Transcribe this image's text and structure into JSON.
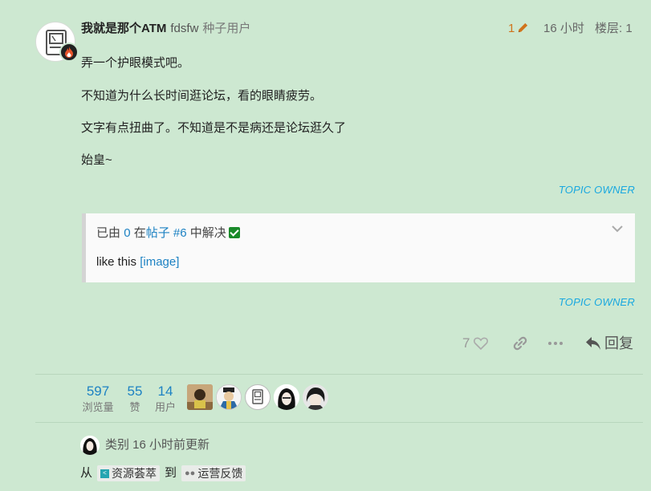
{
  "post": {
    "username": "我就是那个ATM",
    "second_name": "fdsfw",
    "user_title": "种子用户",
    "edit_count": "1",
    "time": "16 小时",
    "floor": "楼层: 1",
    "paragraphs": [
      "弄一个护眼模式吧。",
      "不知道为什么长时间逛论坛，看的眼睛疲劳。",
      "文字有点扭曲了。不知道是不是病还是论坛逛久了",
      "始皇~"
    ],
    "owner_tag": "TOPIC OWNER"
  },
  "solution": {
    "prefix": "已由",
    "solver": "0",
    "mid": "在",
    "post_link": "帖子 #6",
    "suffix": "中解决",
    "quote_text": "like this",
    "image_link": "[image]"
  },
  "actions": {
    "like_count": "7",
    "reply_label": "回复"
  },
  "stats": [
    {
      "num": "597",
      "label": "浏览量"
    },
    {
      "num": "55",
      "label": "赞"
    },
    {
      "num": "14",
      "label": "用户"
    }
  ],
  "footer": {
    "category_text": "类别 16 小时前更新",
    "from_label": "从",
    "from_category": "资源荟萃",
    "to_label": "到",
    "to_category": "运营反馈"
  },
  "colors": {
    "background": "#cde8d1",
    "link": "#1d82c3",
    "owner_tag": "#19a8e0",
    "edit": "#d0731b",
    "check": "#1a8a2a"
  }
}
